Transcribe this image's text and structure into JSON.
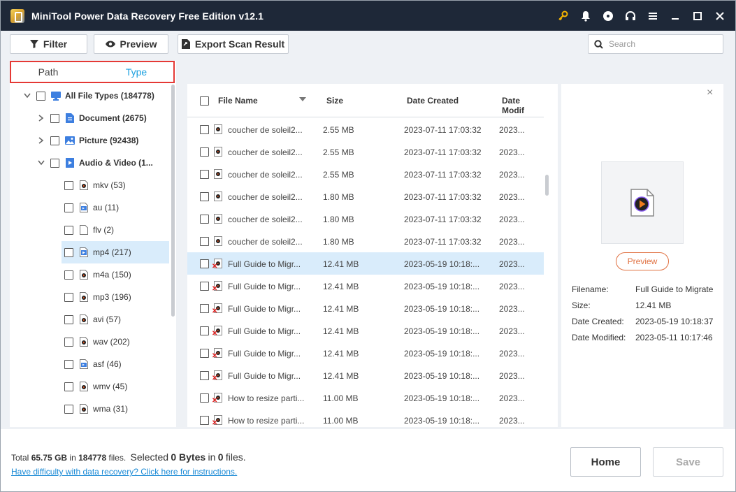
{
  "window": {
    "title": "MiniTool Power Data Recovery Free Edition v12.1",
    "icons": [
      "key-icon",
      "bell-icon",
      "disc-icon",
      "headset-icon",
      "menu-icon",
      "minimize-icon",
      "maximize-icon",
      "close-icon"
    ],
    "accent_color": "#1ca0e0"
  },
  "toolbar": {
    "filter_label": "Filter",
    "preview_label": "Preview",
    "export_label": "Export Scan Result",
    "search_placeholder": "Search"
  },
  "left_panel": {
    "tabs": [
      {
        "label": "Path",
        "active": false
      },
      {
        "label": "Type",
        "active": true
      }
    ],
    "tree": [
      {
        "label": "All File Types (184778)",
        "level": 0,
        "expanded": true,
        "icon": "monitor-icon"
      },
      {
        "label": "Document (2675)",
        "level": 1,
        "expanded": false,
        "icon": "document-icon"
      },
      {
        "label": "Picture (92438)",
        "level": 1,
        "expanded": false,
        "icon": "picture-icon"
      },
      {
        "label": "Audio & Video (1...",
        "level": 1,
        "expanded": true,
        "icon": "audio-video-icon"
      },
      {
        "label": "mkv (53)",
        "level": 2,
        "icon": "media-file-icon"
      },
      {
        "label": "au (11)",
        "level": 2,
        "icon": "audio-file-icon"
      },
      {
        "label": "flv (2)",
        "level": 2,
        "icon": "blank-file-icon"
      },
      {
        "label": "mp4 (217)",
        "level": 2,
        "icon": "mp4-file-icon",
        "selected": true
      },
      {
        "label": "m4a (150)",
        "level": 2,
        "icon": "media-file-icon"
      },
      {
        "label": "mp3 (196)",
        "level": 2,
        "icon": "media-file-icon"
      },
      {
        "label": "avi (57)",
        "level": 2,
        "icon": "media-file-icon"
      },
      {
        "label": "wav (202)",
        "level": 2,
        "icon": "media-file-icon"
      },
      {
        "label": "asf (46)",
        "level": 2,
        "icon": "audio-file-icon"
      },
      {
        "label": "wmv (45)",
        "level": 2,
        "icon": "media-file-icon"
      },
      {
        "label": "wma (31)",
        "level": 2,
        "icon": "media-file-icon"
      }
    ]
  },
  "file_list": {
    "columns": [
      "File Name",
      "Size",
      "Date Created",
      "Date Modif"
    ],
    "rows": [
      {
        "name": "coucher de soleil2...",
        "size": "2.55 MB",
        "created": "2023-07-11 17:03:32",
        "modified": "2023...",
        "deleted": false
      },
      {
        "name": "coucher de soleil2...",
        "size": "2.55 MB",
        "created": "2023-07-11 17:03:32",
        "modified": "2023...",
        "deleted": false
      },
      {
        "name": "coucher de soleil2...",
        "size": "2.55 MB",
        "created": "2023-07-11 17:03:32",
        "modified": "2023...",
        "deleted": false
      },
      {
        "name": "coucher de soleil2...",
        "size": "1.80 MB",
        "created": "2023-07-11 17:03:32",
        "modified": "2023...",
        "deleted": false
      },
      {
        "name": "coucher de soleil2...",
        "size": "1.80 MB",
        "created": "2023-07-11 17:03:32",
        "modified": "2023...",
        "deleted": false
      },
      {
        "name": "coucher de soleil2...",
        "size": "1.80 MB",
        "created": "2023-07-11 17:03:32",
        "modified": "2023...",
        "deleted": false
      },
      {
        "name": "Full Guide to Migr...",
        "size": "12.41 MB",
        "created": "2023-05-19 10:18:...",
        "modified": "2023...",
        "deleted": true,
        "selected": true
      },
      {
        "name": "Full Guide to Migr...",
        "size": "12.41 MB",
        "created": "2023-05-19 10:18:...",
        "modified": "2023...",
        "deleted": true
      },
      {
        "name": "Full Guide to Migr...",
        "size": "12.41 MB",
        "created": "2023-05-19 10:18:...",
        "modified": "2023...",
        "deleted": true
      },
      {
        "name": "Full Guide to Migr...",
        "size": "12.41 MB",
        "created": "2023-05-19 10:18:...",
        "modified": "2023...",
        "deleted": true
      },
      {
        "name": "Full Guide to Migr...",
        "size": "12.41 MB",
        "created": "2023-05-19 10:18:...",
        "modified": "2023...",
        "deleted": true
      },
      {
        "name": "Full Guide to Migr...",
        "size": "12.41 MB",
        "created": "2023-05-19 10:18:...",
        "modified": "2023...",
        "deleted": true
      },
      {
        "name": "How to resize parti...",
        "size": "11.00 MB",
        "created": "2023-05-19 10:18:...",
        "modified": "2023...",
        "deleted": true
      },
      {
        "name": "How to resize parti...",
        "size": "11.00 MB",
        "created": "2023-05-19 10:18:...",
        "modified": "2023...",
        "deleted": true
      }
    ]
  },
  "details": {
    "preview_label": "Preview",
    "fields": [
      {
        "key": "Filename:",
        "value": "Full Guide to Migrate"
      },
      {
        "key": "Size:",
        "value": "12.41 MB"
      },
      {
        "key": "Date Created:",
        "value": "2023-05-19 10:18:37"
      },
      {
        "key": "Date Modified:",
        "value": "2023-05-11 10:17:46"
      }
    ]
  },
  "footer": {
    "total_prefix": "Total",
    "total_size": "65.75 GB",
    "in_word": "in",
    "total_files": "184778",
    "files_word": "files.",
    "selected_prefix": "Selected",
    "selected_size": "0 Bytes",
    "selected_in": "in",
    "selected_files": "0",
    "selected_files_word": "files.",
    "help_link": "Have difficulty with data recovery? Click here for instructions.",
    "home_label": "Home",
    "save_label": "Save"
  }
}
